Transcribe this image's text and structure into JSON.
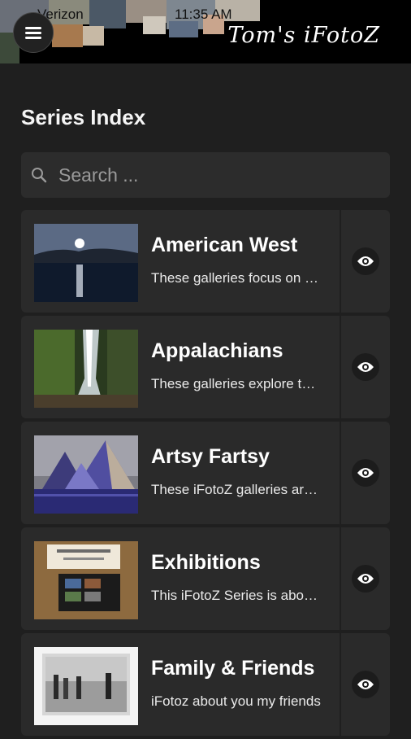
{
  "status_bar": {
    "carrier": "Verizon",
    "time": "11:35 AM"
  },
  "header": {
    "brand": "Tom's iFotoZ"
  },
  "page": {
    "title": "Series Index"
  },
  "search": {
    "placeholder": "Search ..."
  },
  "series": [
    {
      "title": "American West",
      "description": "These galleries focus on the American West",
      "thumb": "sunset-lake"
    },
    {
      "title": "Appalachians",
      "description": "These galleries explore the Appalachians",
      "thumb": "waterfall"
    },
    {
      "title": "Artsy Fartsy",
      "description": "These iFotoZ galleries are artsy",
      "thumb": "pyramids"
    },
    {
      "title": "Exhibitions",
      "description": "This iFotoZ Series is about exhibitions",
      "thumb": "exhibit-sign"
    },
    {
      "title": "Family & Friends",
      "description": "iFotoz about you my friends",
      "thumb": "vintage-photo"
    }
  ],
  "icons": {
    "menu": "menu-icon",
    "search": "search-icon",
    "view": "eye-icon"
  }
}
